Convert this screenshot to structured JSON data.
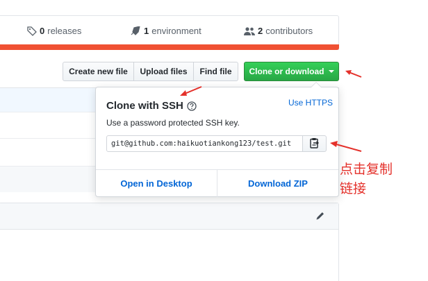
{
  "stats": {
    "releases_count": "0",
    "releases_label": "releases",
    "environment_count": "1",
    "environment_label": "environment",
    "contributors_count": "2",
    "contributors_label": "contributors",
    "language_bar_color": "#f05133"
  },
  "toolbar": {
    "create_label": "Create new file",
    "upload_label": "Upload files",
    "find_label": "Find file",
    "clone_label": "Clone or download"
  },
  "clone_dropdown": {
    "title": "Clone with SSH",
    "switch_link": "Use HTTPS",
    "description": "Use a password protected SSH key.",
    "url": "git@github.com:haikuotiankong123/test.git",
    "open_desktop": "Open in Desktop",
    "download_zip": "Download ZIP"
  },
  "annotation": {
    "line1": "点击复制",
    "line2": "链接",
    "color": "#e4312b"
  },
  "colors": {
    "accent_green": "#28a745",
    "link_blue": "#0366d6"
  }
}
